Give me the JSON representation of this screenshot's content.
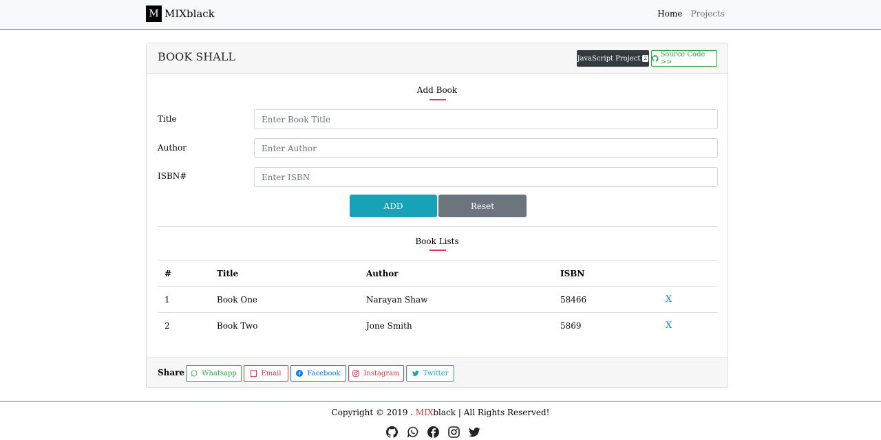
{
  "navbar": {
    "brand_letter": "M",
    "brand_name": "MIXblack",
    "links": [
      "Home",
      "Projects"
    ]
  },
  "card": {
    "title": "BOOK SHALL",
    "js_project_label": "JavaScript Project",
    "js_project_badge": "2",
    "source_code_label": "Source Code >>"
  },
  "form": {
    "heading": "Add Book",
    "fields": [
      {
        "label": "Title",
        "placeholder": "Enter Book Title"
      },
      {
        "label": "Author",
        "placeholder": "Enter Author"
      },
      {
        "label": "ISBN#",
        "placeholder": "Enter ISBN"
      }
    ],
    "add_label": "ADD",
    "reset_label": "Reset"
  },
  "list": {
    "heading": "Book Lists",
    "columns": [
      "#",
      "Title",
      "Author",
      "ISBN"
    ],
    "rows": [
      {
        "num": "1",
        "title": "Book One",
        "author": "Narayan Shaw",
        "isbn": "58466",
        "delete": "X"
      },
      {
        "num": "2",
        "title": "Book Two",
        "author": "Jone Smith",
        "isbn": "5869",
        "delete": "X"
      }
    ]
  },
  "share": {
    "label": "Share -",
    "buttons": [
      "Whatsapp",
      "Email",
      "Facebook",
      "Instagram",
      "Twitter"
    ]
  },
  "footer": {
    "copyright_prefix": "Copyright © 2019 . ",
    "brand_red": "MIX",
    "brand_rest": "black",
    "copyright_suffix": " | All Rights Reserved!"
  },
  "colors": {
    "accent_red": "#dc3545",
    "add_button": "#17a2b8",
    "reset_button": "#6c757d",
    "link_blue": "#007bff",
    "success_green": "#28a745"
  },
  "icons": [
    "github-icon",
    "whatsapp-icon",
    "facebook-icon",
    "instagram-icon",
    "twitter-icon"
  ]
}
